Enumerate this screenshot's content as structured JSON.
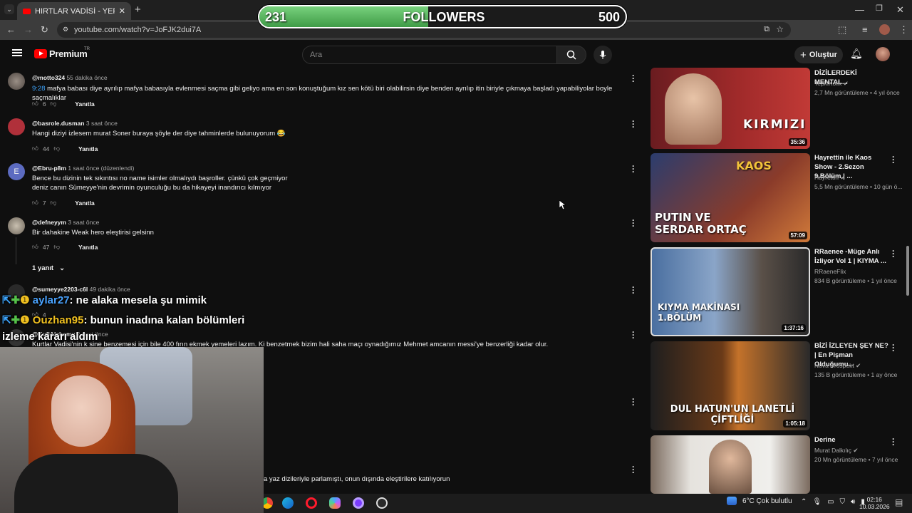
{
  "browser": {
    "tab_title": "HIRTLAR VADİSİ - YERALTI DİZİ",
    "url": "youtube.com/watch?v=JoFJK2dui7A"
  },
  "overlay": {
    "followers_current": "231",
    "followers_label": "FOLLOWERS",
    "followers_goal": "500",
    "followers_progress": 0.462
  },
  "youtube": {
    "logo_text": "Premium",
    "logo_region": "TR",
    "search_placeholder": "Ara",
    "create_label": "Oluştur"
  },
  "comments": [
    {
      "author": "@motto324",
      "time": "55 dakika önce",
      "timestamp_link": "9:28",
      "text": "mafya babası diye ayrılıp mafya babasıyla evlenmesi saçma gibi geliyo ama en son konuştuğum kız sen kötü biri olabilirsin diye benden ayrılıp itin biriyle çıkmaya başladı yapabiliyolar boyle saçmalıklar",
      "likes": "6",
      "reply_label": "Yanıtla"
    },
    {
      "author": "@basrole.dusman",
      "time": "3 saat önce",
      "text": "Hangi diziyi izlesem murat Soner buraya şöyle der diye tahminlerde bulunuyorum 😂",
      "likes": "44",
      "reply_label": "Yanıtla"
    },
    {
      "author": "@Ebru-p8m",
      "time": "1 saat önce (düzenlendi)",
      "avatar_letter": "E",
      "text": "Bence bu dizinin tek sıkıntısı no name isimler olmalıydı başroller. çünkü  çok geçmiyor\n deniz canın  Sümeyye'nin devrimin oyunculuğu bu da hikayeyi inandırıcı kılmıyor",
      "likes": "7",
      "reply_label": "Yanıtla"
    },
    {
      "author": "@defneyym",
      "time": "3 saat önce",
      "text": "Bir dahakine Weak hero eleştirisi gelsinn",
      "likes": "47",
      "reply_label": "Yanıtla",
      "replies_label": "1 yanıt"
    },
    {
      "author": "@sumeyye2203-c6l",
      "time": "49 dakika önce",
      "likes": "4"
    },
    {
      "author": "@KufiAlchemy",
      "time": "2 saat önce",
      "text": "Kurtlar Vadisi'nin  k  sine benzemesi için bile 400 fırın ekmek yemeleri lazım. Ki benzetmek bizim hali saha maçı oynadığımız Mehmet amcanın messi'ye benzerliği kadar olur."
    },
    {
      "text": "a yaz dizileriyle parlamıştı, onun dışında eleştirilere katılıyorun"
    }
  ],
  "chat": [
    {
      "user": "aylar27",
      "message": ": ne alaka mesela şu mimik"
    },
    {
      "user": "Ouzhan95",
      "message": ": bunun inadına kalan bölümleri"
    },
    {
      "message": "izleme kararı aldım"
    }
  ],
  "videos": [
    {
      "title": "DİZİLERDEKİ MENTAL...",
      "channel": "TepkiKolik",
      "stats": "2,7 Mn görüntüleme • 4 yıl önce",
      "duration": "35:36",
      "thumb_text": "KIRMIZI"
    },
    {
      "title": "Hayrettin ile Kaos Show - 2.Sezon 9.Bölüm | ...",
      "channel": "Hayrettin",
      "stats": "5,5 Mn görüntüleme • 10 gün ö...",
      "duration": "57:09",
      "thumb_text": "PUTIN VE SERDAR ORTAÇ",
      "thumb_brand": "KAOS"
    },
    {
      "title": "RRaenee -Müge Anlı İzliyor Vol 1 | KIYMA ...",
      "channel": "RRaeneFlix",
      "stats": "834 B görüntüleme • 1 yıl önce",
      "duration": "1:37:16",
      "thumb_text": "KIYMA MAKİNASI 1.BÖLÜM"
    },
    {
      "title": "BİZİ İZLEYEN ŞEY NE? | En Pişman Olduğumu...",
      "channel": "Nova Prospekt",
      "stats": "135 B görüntüleme • 1 ay önce",
      "duration": "1:05:18",
      "thumb_text": "DUL HATUN'UN LANETLİ ÇİFTLİĞİ"
    },
    {
      "title": "Derine",
      "channel": "Murat Dalkılıç",
      "stats": "20 Mn görüntüleme • 7 yıl önce"
    }
  ],
  "taskbar": {
    "weather": "6°C  Çok bulutlu",
    "time": "02:16",
    "date": "10.03.2026"
  }
}
